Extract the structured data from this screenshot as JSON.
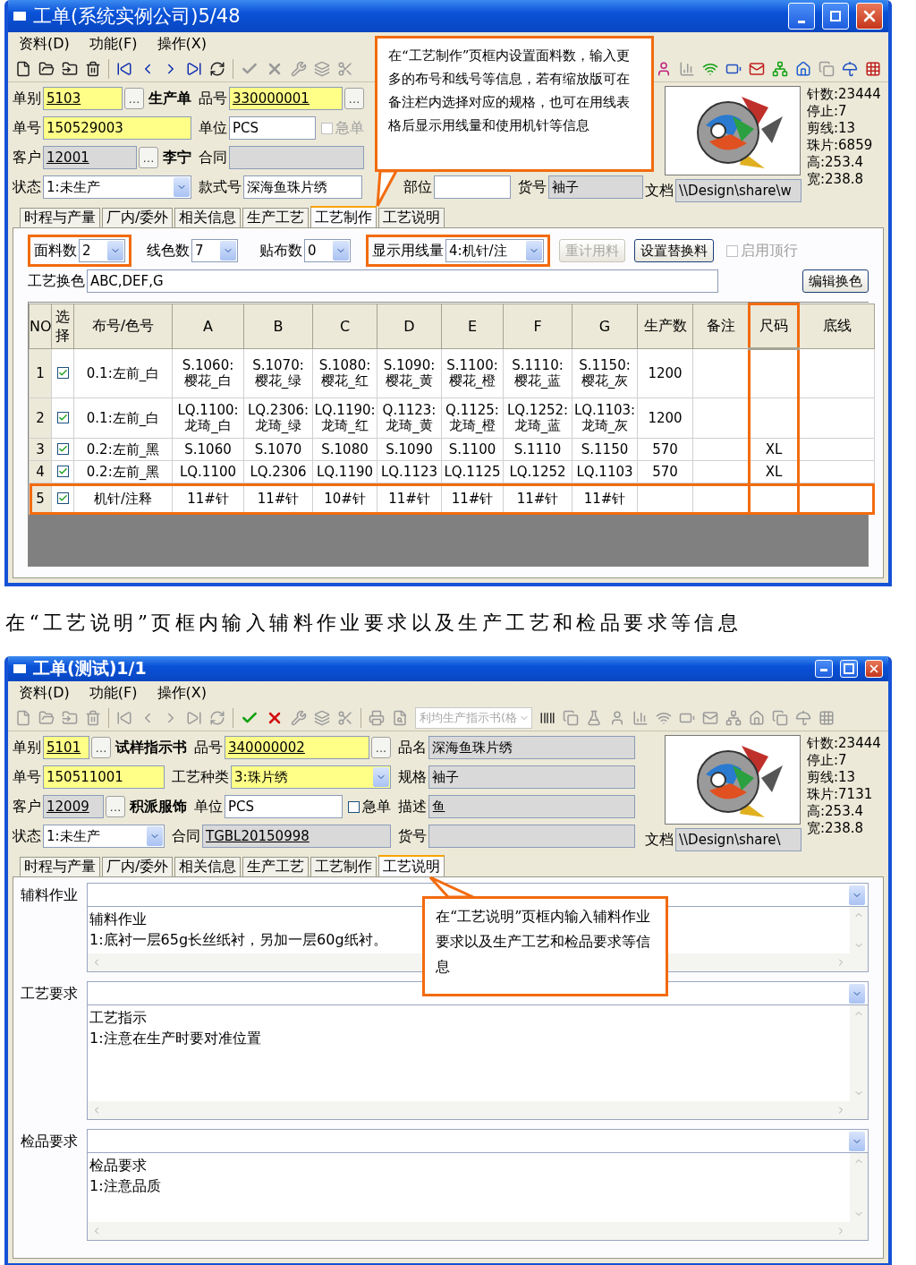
{
  "window_1": {
    "title": "工单(系统实例公司)5/48",
    "menu": [
      "资料(D)",
      "功能(F)",
      "操作(X)"
    ],
    "toolbar": {
      "confirm_enabled": false
    },
    "form": [
      [
        {
          "label": "单别",
          "value": "5103",
          "required": true,
          "link": true,
          "more": "…",
          "note": "生产单"
        },
        {
          "label": "品号",
          "value": "330000001",
          "required": true,
          "link": true,
          "more": "…"
        }
      ],
      [
        {
          "label": "单号",
          "value": "150529003",
          "required": true
        },
        {
          "label": "单位",
          "value": "PCS",
          "check": {
            "label": "急单",
            "checked": false,
            "disabled": true
          }
        }
      ],
      [
        {
          "label": "客户",
          "value": "12001",
          "readonly": true,
          "link": true,
          "more": "…",
          "note": "李宁"
        },
        {
          "label": "合同",
          "readonly": true
        }
      ],
      [
        {
          "label": "状态",
          "value": "1:未生产",
          "combo": true
        },
        {
          "label": "款式号",
          "value": "深海鱼珠片绣"
        },
        {
          "label": "部位"
        },
        {
          "label": "货号",
          "value": "袖子",
          "readonly": true
        }
      ]
    ],
    "document": {
      "label": "文档",
      "value": "\\\\Design\\share\\w"
    },
    "stats": [
      "针数:23444",
      "停止:7",
      "剪线:13",
      "珠片:6859",
      "高:253.4",
      "宽:238.8"
    ],
    "tabs": [
      {
        "label": "时程与产量",
        "selected": false
      },
      {
        "label": "厂内/委外",
        "selected": false
      },
      {
        "label": "相关信息",
        "selected": false
      },
      {
        "label": "生产工艺",
        "selected": false
      },
      {
        "label": "工艺制作",
        "selected": true
      },
      {
        "label": "工艺说明",
        "selected": false
      }
    ],
    "options": [
      {
        "kind": "combo",
        "label": "面料数",
        "value": "2",
        "highlighted": true
      },
      {
        "kind": "combo",
        "label": "线色数",
        "value": "7",
        "highlighted": false
      },
      {
        "kind": "combo",
        "label": "贴布数",
        "value": "0",
        "highlighted": false
      },
      {
        "kind": "combo",
        "label": "显示用线量",
        "value": "4:机针/注",
        "highlighted": true
      },
      {
        "kind": "button",
        "label": "重计用料",
        "disabled": true
      },
      {
        "kind": "button",
        "label": "设置替换料",
        "disabled": false
      },
      {
        "kind": "check",
        "label": "启用顶行",
        "checked": false,
        "disabled": true
      }
    ],
    "color_change": {
      "label": "工艺换色",
      "value": "ABC,DEF,G",
      "button": "编辑换色"
    },
    "table": {
      "columns": [
        {
          "label": "NO",
          "highlighted": false
        },
        {
          "label": "选择",
          "highlighted": false
        },
        {
          "label": "布号/色号",
          "highlighted": false
        },
        {
          "label": "A",
          "highlighted": false
        },
        {
          "label": "B",
          "highlighted": false
        },
        {
          "label": "C",
          "highlighted": false
        },
        {
          "label": "D",
          "highlighted": false
        },
        {
          "label": "E",
          "highlighted": false
        },
        {
          "label": "F",
          "highlighted": false
        },
        {
          "label": "G",
          "highlighted": false
        },
        {
          "label": "生产数",
          "highlighted": false
        },
        {
          "label": "备注",
          "highlighted": false
        },
        {
          "label": "尺码",
          "highlighted": true
        },
        {
          "label": "底线",
          "highlighted": false
        }
      ],
      "rows": [
        {
          "checked": true,
          "highlighted": false,
          "cells": [
            "1",
            "",
            "0.1:左前_白",
            "S.1060:\n樱花_白",
            "S.1070:\n樱花_绿",
            "S.1080:\n樱花_红",
            "S.1090:\n樱花_黄",
            "S.1100:\n樱花_橙",
            "S.1110:\n樱花_蓝",
            "S.1150:\n樱花_灰",
            "1200",
            "",
            "",
            ""
          ]
        },
        {
          "checked": true,
          "highlighted": false,
          "cells": [
            "2",
            "",
            "0.1:左前_白",
            "LQ.1100:\n龙琦_白",
            "LQ.2306:\n龙琦_绿",
            "LQ.1190:\n龙琦_红",
            "Q.1123:\n龙琦_黄",
            "Q.1125:\n龙琦_橙",
            "LQ.1252:\n龙琦_蓝",
            "LQ.1103:\n龙琦_灰",
            "1200",
            "",
            "",
            ""
          ]
        },
        {
          "checked": true,
          "highlighted": false,
          "cells": [
            "3",
            "",
            "0.2:左前_黑",
            "S.1060",
            "S.1070",
            "S.1080",
            "S.1090",
            "S.1100",
            "S.1110",
            "S.1150",
            "570",
            "",
            "XL",
            ""
          ]
        },
        {
          "checked": true,
          "highlighted": false,
          "cells": [
            "4",
            "",
            "0.2:左前_黑",
            "LQ.1100",
            "LQ.2306",
            "LQ.1190",
            "LQ.1123",
            "LQ.1125",
            "LQ.1252",
            "LQ.1103",
            "570",
            "",
            "XL",
            ""
          ]
        },
        {
          "checked": true,
          "highlighted": true,
          "cells": [
            "5",
            "",
            "机针/注释",
            "11#针",
            "11#针",
            "10#针",
            "11#针",
            "11#针",
            "11#针",
            "11#针",
            "",
            "",
            "",
            ""
          ]
        }
      ]
    },
    "callout": "在“工艺制作”页框内设置面料数，输入更多的布号和线号等信息，若有缩放版可在备注栏内选择对应的规格，也可在用线表格后显示用线量和使用机针等信息"
  },
  "caption": "在“工艺说明”页框内输入辅料作业要求以及生产工艺和检品要求等信息",
  "window_2": {
    "title": "工单(测试)1/1",
    "menu": [
      "资料(D)",
      "功能(F)",
      "操作(X)"
    ],
    "toolbar": {
      "confirm_enabled": true,
      "combo": "利均生产指示书(格"
    },
    "form": [
      [
        {
          "label": "单别",
          "value": "5101",
          "required": true,
          "link": true,
          "more": "…",
          "note": "试样指示书"
        },
        {
          "label": "品号",
          "value": "340000002",
          "required": true,
          "link": true,
          "more": "..."
        },
        {
          "label": "品名",
          "value": "深海鱼珠片绣",
          "readonly": true
        }
      ],
      [
        {
          "label": "单号",
          "value": "150511001",
          "required": true
        },
        {
          "label": "工艺种类",
          "value": "3:珠片绣",
          "required": true,
          "combo": true
        },
        {
          "label": "规格",
          "value": "袖子",
          "readonly": true
        }
      ],
      [
        {
          "label": "客户",
          "value": "12009",
          "readonly": true,
          "link": true,
          "more": "…",
          "note": "积派服饰"
        },
        {
          "label": "单位",
          "value": "PCS",
          "check": {
            "label": "急单",
            "checked": false,
            "disabled": false
          }
        },
        {
          "label": "描述",
          "value": "鱼",
          "readonly": true
        }
      ],
      [
        {
          "label": "状态",
          "value": "1:未生产",
          "combo": true
        },
        {
          "label": "合同",
          "value": "TGBL20150998",
          "readonly": true,
          "link": true
        },
        {
          "label": "货号",
          "readonly": true
        }
      ]
    ],
    "document": {
      "label": "文档",
      "value": "\\\\Design\\share\\"
    },
    "stats": [
      "针数:23444",
      "停止:7",
      "剪线:13",
      "珠片:7131",
      "高:253.4",
      "宽:238.8"
    ],
    "tabs": [
      {
        "label": "时程与产量",
        "selected": false
      },
      {
        "label": "厂内/委外",
        "selected": false
      },
      {
        "label": "相关信息",
        "selected": false
      },
      {
        "label": "生产工艺",
        "selected": false
      },
      {
        "label": "工艺制作",
        "selected": false
      },
      {
        "label": "工艺说明",
        "selected": true
      }
    ],
    "sections": [
      {
        "label": "辅料作业",
        "lines": [
          "辅料作业",
          "1:底衬一层65g长丝纸衬，另加一层60g纸衬。"
        ]
      },
      {
        "label": "工艺要求",
        "lines": [
          "工艺指示",
          "1:注意在生产时要对准位置"
        ]
      },
      {
        "label": "检品要求",
        "lines": [
          "检品要求",
          "1:注意品质"
        ]
      }
    ],
    "callout": "在“工艺说明”页框内输入辅料作业要求以及生产工艺和检品要求等信息"
  }
}
